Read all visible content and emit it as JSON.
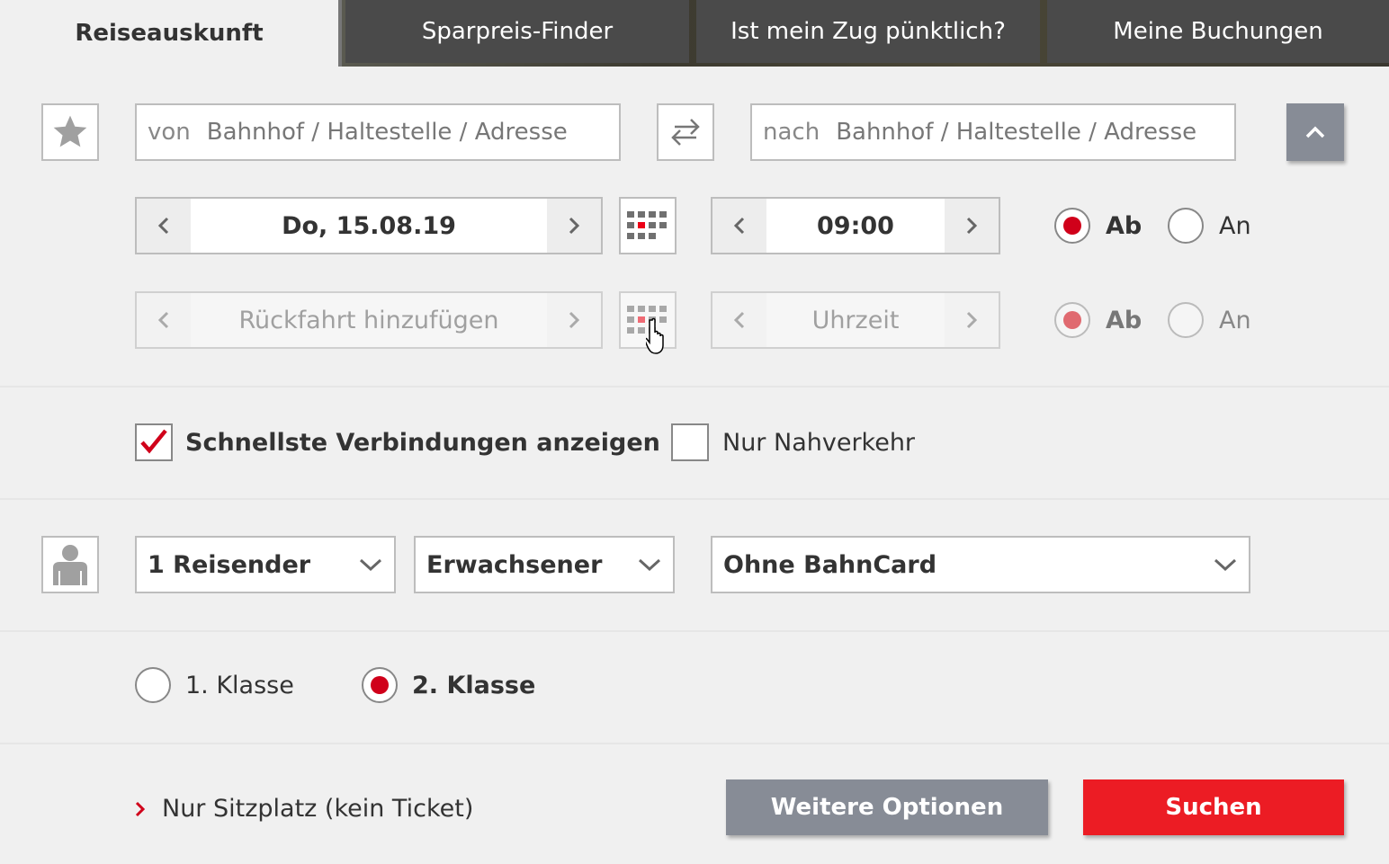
{
  "tabs": [
    {
      "label": "Reiseauskunft",
      "active": true
    },
    {
      "label": "Sparpreis-Finder"
    },
    {
      "label": "Ist mein Zug pünktlich?"
    },
    {
      "label": "Meine Buchungen"
    }
  ],
  "route": {
    "from_prefix": "von",
    "from_placeholder": "Bahnhof / Haltestelle / Adresse",
    "to_prefix": "nach",
    "to_placeholder": "Bahnhof / Haltestelle / Adresse"
  },
  "outbound": {
    "date": "Do, 15.08.19",
    "time": "09:00",
    "depart_label": "Ab",
    "arrive_label": "An",
    "selected": "Ab"
  },
  "return": {
    "date_placeholder": "Rückfahrt hinzufügen",
    "time_placeholder": "Uhrzeit",
    "depart_label": "Ab",
    "arrive_label": "An",
    "selected": "Ab"
  },
  "options": {
    "fastest_label": "Schnellste Verbindungen anzeigen",
    "fastest_checked": true,
    "local_label": "Nur Nahverkehr",
    "local_checked": false
  },
  "travelers": {
    "count": "1 Reisender",
    "age": "Erwachsener",
    "bahncard": "Ohne BahnCard"
  },
  "class": {
    "first_label": "1. Klasse",
    "second_label": "2. Klasse",
    "selected": "2. Klasse"
  },
  "footer": {
    "seat_only_link": "Nur Sitzplatz (kein Ticket)",
    "more_options_label": "Weitere Optionen",
    "search_label": "Suchen"
  },
  "colors": {
    "accent_red": "#ec0016",
    "radio_red": "#d0001a",
    "secondary_button": "#878c96"
  },
  "icons": [
    "star-icon",
    "swap-icon",
    "chevron-up-icon",
    "chevron-left-icon",
    "chevron-right-icon",
    "calendar-icon",
    "hand-cursor-icon",
    "checkmark-icon",
    "person-icon",
    "chevron-down-icon",
    "link-chevron-icon"
  ]
}
